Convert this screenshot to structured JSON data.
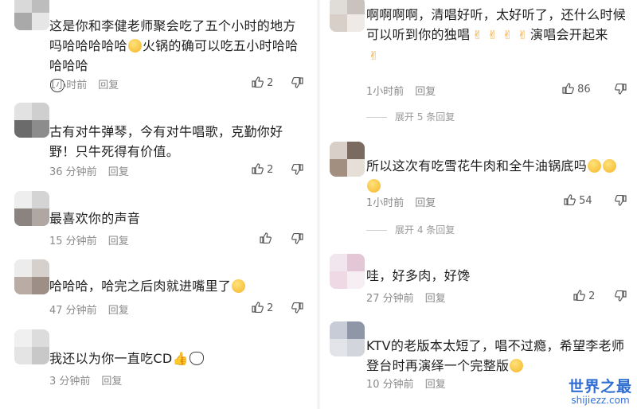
{
  "left_comments": [
    {
      "text": "这是你和李健老师聚会吃了五个小时的地方吗哈哈哈哈哈",
      "text_after": "火锅的确可以吃五小时哈哈哈哈哈",
      "time": "1小时前",
      "reply": "回复",
      "likes": "2"
    },
    {
      "text": "古有对牛弹琴，今有对牛唱歌，克勤你好野！只牛死得有价值。",
      "time": "36 分钟前",
      "reply": "回复",
      "likes": "2"
    },
    {
      "text": "最喜欢你的声音",
      "time": "15 分钟前",
      "reply": "回复",
      "likes": ""
    },
    {
      "text": "哈哈哈，哈完之后肉就进嘴里了",
      "time": "47 分钟前",
      "reply": "回复",
      "likes": "2"
    },
    {
      "text": "我还以为你一直吃CD",
      "time": "3 分钟前",
      "reply": "回复",
      "likes": ""
    }
  ],
  "right_comments": [
    {
      "text": "啊啊啊啊，清唱好听，太好听了，还什么时候可以听到你的独唱",
      "text_after": "演唱会开起来",
      "time": "1小时前",
      "reply": "回复",
      "likes": "86",
      "expand": "展开 5 条回复"
    },
    {
      "text": "所以这次有吃雪花牛肉和全牛油锅底吗",
      "time": "1小时前",
      "reply": "回复",
      "likes": "54",
      "expand": "展开 4 条回复"
    },
    {
      "text": "哇，好多肉，好馋",
      "time": "27 分钟前",
      "reply": "回复",
      "likes": "2"
    },
    {
      "text": "KTV的老版本太短了，唱不过瘾，希望李老师登台时再演绎一个完整版",
      "time": "10 分钟前",
      "reply": "回复",
      "likes": ""
    }
  ],
  "watermark": {
    "title": "世界之最",
    "url": "shijiezz.com"
  },
  "colors": {
    "text": "#1e1e1e",
    "meta": "#8a8a8a",
    "watermark": "#2f6fd3"
  }
}
